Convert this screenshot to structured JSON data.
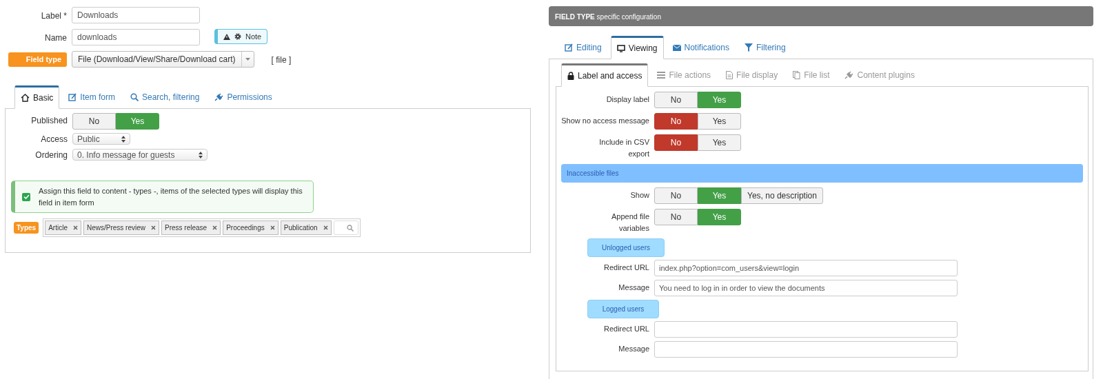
{
  "field_form": {
    "fields": [
      {
        "kind": "text",
        "label": "Label *",
        "value": "Downloads"
      },
      {
        "kind": "text",
        "label": "Name",
        "value": "downloads",
        "note": "Note"
      },
      {
        "kind": "select",
        "label": "Field type",
        "value": "File (Download/View/Share/Download cart)",
        "suffix": "[ file ]"
      }
    ],
    "tabs": [
      {
        "label": "Basic",
        "selected": true
      },
      {
        "label": "Item form",
        "selected": false
      },
      {
        "label": "Search, filtering",
        "selected": false
      },
      {
        "label": "Permissions",
        "selected": false
      }
    ],
    "rows": [
      {
        "kind": "toggle",
        "label": "Published",
        "options": [
          {
            "label": "No",
            "selected": false
          },
          {
            "label": "Yes",
            "selected": true,
            "color": "#43a047"
          }
        ]
      },
      {
        "kind": "select",
        "label": "Access",
        "value": "Public"
      },
      {
        "kind": "select",
        "label": "Ordering",
        "value": "0. Info message for guests"
      }
    ],
    "assign": {
      "checked": true,
      "text": "Assign this field to content - types -, items of the selected types will display this field in item form"
    },
    "types": {
      "label": "Types",
      "tags": [
        "Article",
        "News/Press review",
        "Press release",
        "Proceedings",
        "Publication"
      ]
    }
  },
  "config": {
    "title": "**FIELD TYPE** specific configuration",
    "tabs": [
      {
        "label": "Editing",
        "selected": false
      },
      {
        "label": "Viewing",
        "selected": true
      },
      {
        "label": "Notifications",
        "selected": false
      },
      {
        "label": "Filtering",
        "selected": false
      }
    ],
    "subtabs": [
      {
        "label": "Label and access",
        "selected": true
      },
      {
        "label": "File actions",
        "selected": false
      },
      {
        "label": "File display",
        "selected": false
      },
      {
        "label": "File list",
        "selected": false
      },
      {
        "label": "Content plugins",
        "selected": false
      }
    ],
    "rows": [
      {
        "kind": "toggle",
        "label": "Display label",
        "options": [
          {
            "label": "No",
            "selected": false
          },
          {
            "label": "Yes",
            "selected": true,
            "color": "#43a047"
          }
        ]
      },
      {
        "kind": "toggle",
        "label": "Show no access message",
        "options": [
          {
            "label": "No",
            "selected": true,
            "color": "#c0392b"
          },
          {
            "label": "Yes",
            "selected": false
          }
        ]
      },
      {
        "kind": "toggle",
        "label": "Include in CSV export",
        "options": [
          {
            "label": "No",
            "selected": true,
            "color": "#c0392b"
          },
          {
            "label": "Yes",
            "selected": false
          }
        ]
      },
      {
        "kind": "section",
        "label": "Inaccessible files"
      },
      {
        "kind": "toggle",
        "label": "Show",
        "options": [
          {
            "label": "No",
            "selected": false
          },
          {
            "label": "Yes",
            "selected": true,
            "color": "#43a047"
          },
          {
            "label": "Yes, no description",
            "selected": false
          }
        ]
      },
      {
        "kind": "toggle",
        "label": "Append file variables",
        "options": [
          {
            "label": "No",
            "selected": false
          },
          {
            "label": "Yes",
            "selected": true,
            "color": "#43a047"
          }
        ]
      },
      {
        "kind": "subsection",
        "label": "Unlogged users"
      },
      {
        "kind": "text",
        "label": "Redirect URL",
        "value": "index.php?option=com_users&view=login"
      },
      {
        "kind": "text",
        "label": "Message",
        "value": "You need to log in in order to view the documents"
      },
      {
        "kind": "subsection",
        "label": "Logged users"
      },
      {
        "kind": "text",
        "label": "Redirect URL"
      },
      {
        "kind": "text",
        "label": "Message"
      }
    ]
  }
}
